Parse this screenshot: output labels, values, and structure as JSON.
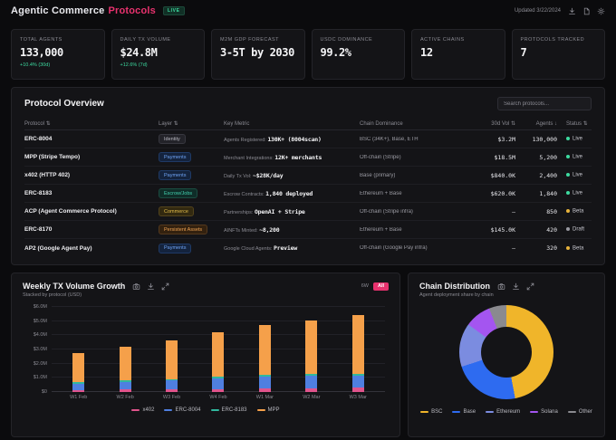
{
  "header": {
    "title_main": "Agentic Commerce",
    "title_accent": "Protocols",
    "live_badge": "LIVE",
    "updated": "Updated 3/22/2024",
    "icons": [
      "download-icon",
      "document-icon",
      "gear-icon"
    ]
  },
  "stats": [
    {
      "label": "TOTAL AGENTS",
      "value": "133,000",
      "delta": "+10.4% (30d)"
    },
    {
      "label": "DAILY TX VOLUME",
      "value": "$24.8M",
      "delta": "+12.6% (7d)"
    },
    {
      "label": "M2M GDP FORECAST",
      "value": "3-5T by 2030",
      "delta": ""
    },
    {
      "label": "USDC DOMINANCE",
      "value": "99.2%",
      "delta": ""
    },
    {
      "label": "ACTIVE CHAINS",
      "value": "12",
      "delta": ""
    },
    {
      "label": "PROTOCOLS TRACKED",
      "value": "7",
      "delta": ""
    }
  ],
  "table": {
    "title": "Protocol Overview",
    "search_placeholder": "Search protocols...",
    "columns": [
      {
        "label": "Protocol",
        "sort": "⇅"
      },
      {
        "label": "Layer",
        "sort": "⇅"
      },
      {
        "label": "Key Metric",
        "sort": ""
      },
      {
        "label": "Chain Dominance",
        "sort": ""
      },
      {
        "label": "30d Vol",
        "sort": "⇅"
      },
      {
        "label": "Agents",
        "sort": "↓"
      },
      {
        "label": "Status",
        "sort": "⇅"
      }
    ],
    "rows": [
      {
        "protocol": "ERC-8004",
        "layer": "Identity",
        "layer_style": "identity",
        "metric_label": "Agents Registered: ",
        "metric_value": "130K+ (8004scan)",
        "chain": "BSC (34K+), Base, ETH",
        "vol": "$3.2M",
        "agents": "130,000",
        "status": "Live",
        "status_style": "live"
      },
      {
        "protocol": "MPP (Stripe Tempo)",
        "layer": "Payments",
        "layer_style": "payments",
        "metric_label": "Merchant Integrations: ",
        "metric_value": "12K+ merchants",
        "chain": "Off-chain (Stripe)",
        "vol": "$18.5M",
        "agents": "5,200",
        "status": "Live",
        "status_style": "live"
      },
      {
        "protocol": "x402 (HTTP 402)",
        "layer": "Payments",
        "layer_style": "payments",
        "metric_label": "Daily Tx Vol: ",
        "metric_value": "~$28K/day",
        "chain": "Base (primary)",
        "vol": "$840.0K",
        "agents": "2,400",
        "status": "Live",
        "status_style": "live"
      },
      {
        "protocol": "ERC-8183",
        "layer": "Escrow/Jobs",
        "layer_style": "escrow",
        "metric_label": "Escrow Contracts: ",
        "metric_value": "1,840 deployed",
        "chain": "Ethereum + Base",
        "vol": "$620.0K",
        "agents": "1,840",
        "status": "Live",
        "status_style": "live"
      },
      {
        "protocol": "ACP (Agent Commerce Protocol)",
        "layer": "Commerce",
        "layer_style": "commerce",
        "metric_label": "Partnerships: ",
        "metric_value": "OpenAI + Stripe",
        "chain": "Off-chain (Stripe infra)",
        "vol": "–",
        "agents": "850",
        "status": "Beta",
        "status_style": "beta"
      },
      {
        "protocol": "ERC-8170",
        "layer": "Persistent Assets",
        "layer_style": "assets",
        "metric_label": "AINFTs Minted: ",
        "metric_value": "~8,200",
        "chain": "Ethereum + Base",
        "vol": "$145.0K",
        "agents": "420",
        "status": "Draft",
        "status_style": "draft"
      },
      {
        "protocol": "AP2 (Google Agent Pay)",
        "layer": "Payments",
        "layer_style": "payments",
        "metric_label": "Google Cloud Agents: ",
        "metric_value": "Preview",
        "chain": "Off-chain (Google Pay infra)",
        "vol": "–",
        "agents": "320",
        "status": "Beta",
        "status_style": "beta"
      }
    ]
  },
  "tx_chart": {
    "title": "Weekly TX Volume Growth",
    "subtitle": "Stacked by protocol (USD)",
    "range_label": "6W",
    "range_selected": "All",
    "icons": [
      "camera-icon",
      "download-icon",
      "expand-icon"
    ]
  },
  "chain_chart": {
    "title": "Chain Distribution",
    "subtitle": "Agent deployment share by chain",
    "icons": [
      "camera-icon",
      "download-icon",
      "expand-icon"
    ]
  },
  "chart_data": [
    {
      "type": "bar",
      "stacked": true,
      "title": "Weekly TX Volume Growth",
      "subtitle": "Stacked by protocol (USD)",
      "categories": [
        "W1 Feb",
        "W2 Feb",
        "W3 Feb",
        "W4 Feb",
        "W1 Mar",
        "W2 Mar",
        "W3 Mar"
      ],
      "series": [
        {
          "name": "x402",
          "color": "#e0548c",
          "values": [
            0.15,
            0.18,
            0.2,
            0.22,
            0.25,
            0.25,
            0.3
          ]
        },
        {
          "name": "ERC-8004",
          "color": "#4f7fe0",
          "values": [
            0.45,
            0.55,
            0.62,
            0.75,
            0.85,
            0.9,
            0.85
          ]
        },
        {
          "name": "ERC-8183",
          "color": "#30b89e",
          "values": [
            0.08,
            0.09,
            0.1,
            0.12,
            0.12,
            0.13,
            0.15
          ]
        },
        {
          "name": "MPP",
          "color": "#f5a04a",
          "values": [
            2.07,
            2.38,
            2.73,
            3.11,
            3.48,
            3.77,
            4.1
          ]
        }
      ],
      "totals": [
        2.75,
        3.2,
        3.65,
        4.2,
        4.7,
        5.05,
        5.4
      ],
      "unit": "millions USD",
      "ylim": [
        0,
        6
      ],
      "yticks": [
        {
          "v": 6,
          "label": "$6.0M"
        },
        {
          "v": 5,
          "label": "$5.0M"
        },
        {
          "v": 4,
          "label": "$4.0M"
        },
        {
          "v": 3,
          "label": "$3.0M"
        },
        {
          "v": 2,
          "label": "$2.0M"
        },
        {
          "v": 1,
          "label": "$1.0M"
        },
        {
          "v": 0,
          "label": "$0"
        }
      ],
      "grid": true,
      "legend_position": "bottom"
    },
    {
      "type": "pie",
      "donut": true,
      "title": "Chain Distribution",
      "subtitle": "Agent deployment share by chain",
      "labels": [
        "BSC",
        "Base",
        "Ethereum",
        "Solana",
        "Other"
      ],
      "values": [
        47,
        23,
        15,
        9,
        6
      ],
      "unit": "percent share",
      "colors": [
        "#f0b52a",
        "#2e6bf0",
        "#7b8ce0",
        "#a455f0",
        "#8a8a8f"
      ],
      "legend_position": "bottom"
    }
  ]
}
